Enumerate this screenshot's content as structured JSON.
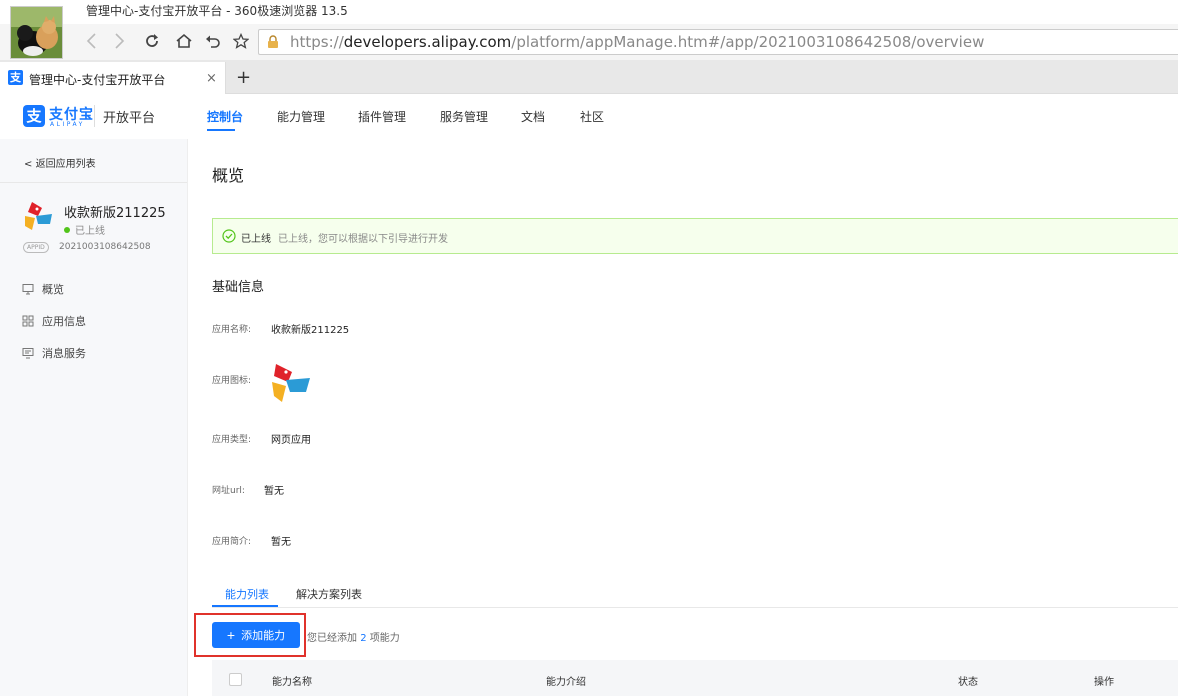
{
  "browser": {
    "window_title": "管理中心-支付宝开放平台 - 360极速浏览器 13.5",
    "url_prefix": "https://",
    "url_host": "developers.alipay.com",
    "url_path": "/platform/appManage.htm#/app/2021003108642508/overview",
    "tab_label": "管理中心-支付宝开放平台",
    "tab_close": "×",
    "new_tab": "+"
  },
  "header": {
    "logo_text": "支付宝",
    "logo_sub": "ALIPAY",
    "platform": "开放平台",
    "nav": [
      "控制台",
      "能力管理",
      "插件管理",
      "服务管理",
      "文档",
      "社区"
    ]
  },
  "sidebar": {
    "back": "返回应用列表",
    "app_name": "收款新版211225",
    "app_status": "已上线",
    "appid_badge": "APPID",
    "appid": "2021003108642508",
    "items": [
      "概览",
      "应用信息",
      "消息服务"
    ]
  },
  "main": {
    "title": "概览",
    "alert_title": "已上线",
    "alert_desc": "已上线，您可以根据以下引导进行开发",
    "section_title": "基础信息",
    "fields": {
      "name_label": "应用名称:",
      "name_value": "收款新版211225",
      "icon_label": "应用图标:",
      "type_label": "应用类型:",
      "type_value": "网页应用",
      "url_label": "网址url:",
      "url_value": "暂无",
      "desc_label": "应用简介:",
      "desc_value": "暂无"
    },
    "subtabs": [
      "能力列表",
      "解决方案列表"
    ],
    "add_button": "添加能力",
    "added_prefix": "您已经添加",
    "added_count": "2",
    "added_suffix": "项能力",
    "table_headers": [
      "能力名称",
      "能力介绍",
      "状态",
      "操作"
    ]
  },
  "colors": {
    "accent": "#1677ff",
    "success": "#52c41a",
    "highlight": "#e0322b"
  }
}
